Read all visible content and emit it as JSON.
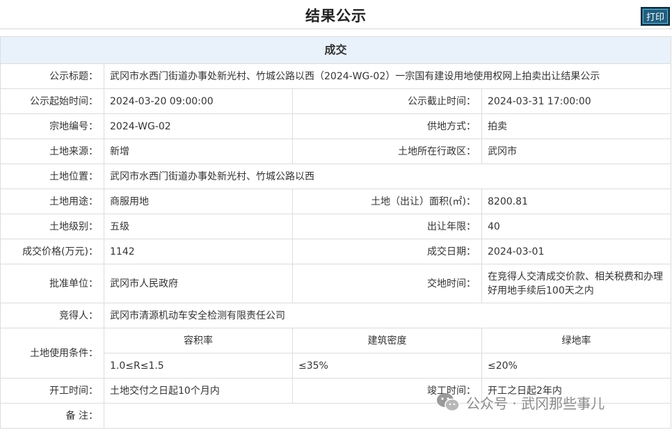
{
  "header": {
    "title": "结果公示",
    "print_label": "打印"
  },
  "section_title": "成交",
  "rows": {
    "notice_title": {
      "label": "公示标题：",
      "value": "武冈市水西门街道办事处新光村、竹城公路以西（2024-WG-02）一宗国有建设用地使用权网上拍卖出让结果公示"
    },
    "start_time": {
      "label": "公示起始时间：",
      "value": "2024-03-20 09:00:00"
    },
    "end_time": {
      "label": "公示截止时间：",
      "value": "2024-03-31 17:00:00"
    },
    "parcel_no": {
      "label": "宗地编号：",
      "value": "2024-WG-02"
    },
    "supply_method": {
      "label": "供地方式：",
      "value": "拍卖"
    },
    "land_source": {
      "label": "土地来源：",
      "value": "新增"
    },
    "district": {
      "label": "土地所在行政区：",
      "value": "武冈市"
    },
    "location": {
      "label": "土地位置：",
      "value": "武冈市水西门街道办事处新光村、竹城公路以西"
    },
    "land_use": {
      "label": "土地用途：",
      "value": "商服用地"
    },
    "area": {
      "label": "土地（出让）面积(㎡)：",
      "value": "8200.81"
    },
    "land_grade": {
      "label": "土地级别：",
      "value": "五级"
    },
    "term": {
      "label": "出让年限：",
      "value": "40"
    },
    "price": {
      "label": "成交价格(万元)：",
      "value": "1142"
    },
    "deal_date": {
      "label": "成交日期：",
      "value": "2024-03-01"
    },
    "approver": {
      "label": "批准单位：",
      "value": "武冈市人民政府"
    },
    "delivery_time": {
      "label": "交地时间：",
      "value": "在竞得人交清成交价款、相关税费和办理好用地手续后100天之内"
    },
    "winner": {
      "label": "竞得人：",
      "value": "武冈市清源机动车安全检测有限责任公司"
    },
    "conditions": {
      "label": "土地使用条件：",
      "far_header": "容积率",
      "far_value": "1.0≤R≤1.5",
      "density_header": "建筑密度",
      "density_value": "≤35%",
      "green_header": "绿地率",
      "green_value": "≤20%"
    },
    "start_work": {
      "label": "开工时间：",
      "value": "土地交付之日起10个月内"
    },
    "finish_work": {
      "label": "竣工时间：",
      "value": "开工之日起2年内"
    },
    "remarks": {
      "label": "备 注：",
      "value": ""
    }
  },
  "watermark": {
    "icon": "wechat-icon",
    "text": "公众号 · 武冈那些事儿"
  }
}
